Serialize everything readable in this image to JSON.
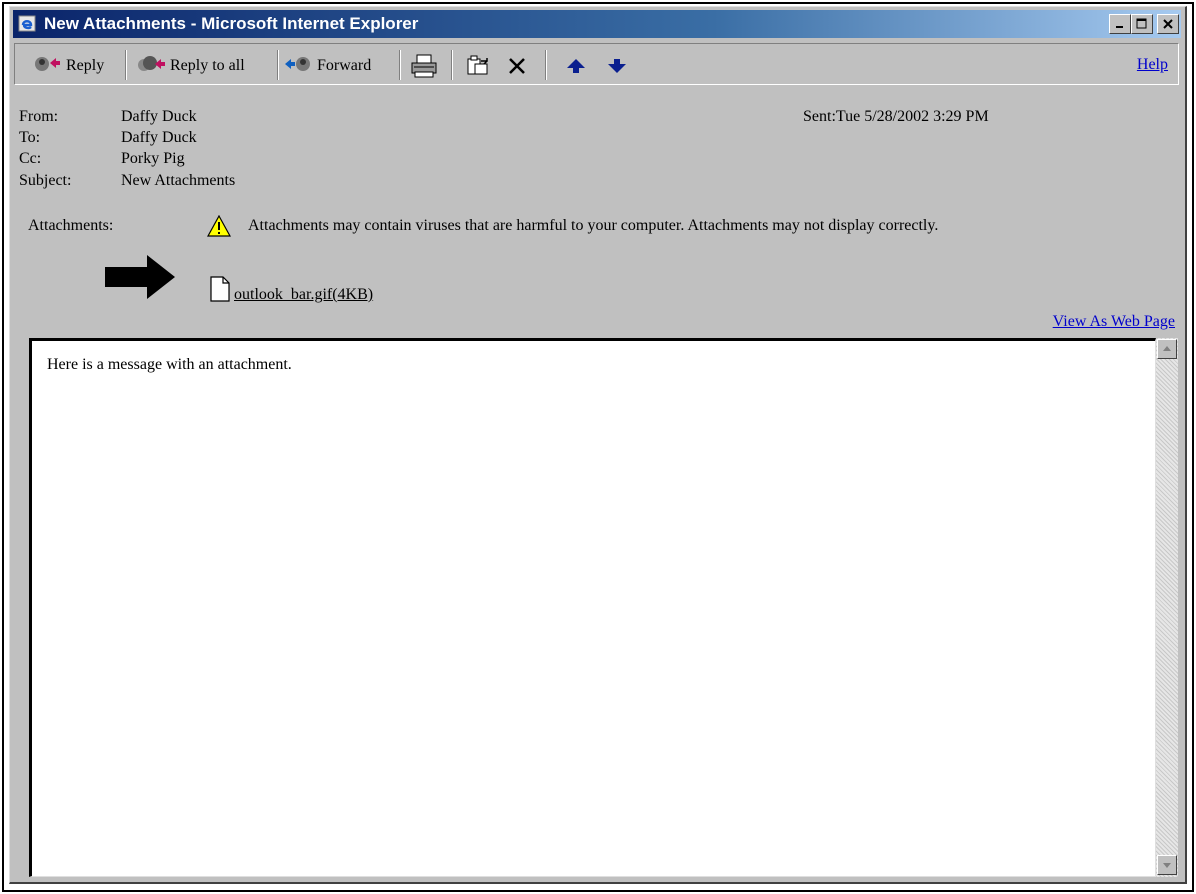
{
  "window": {
    "title": "New Attachments - Microsoft Internet Explorer"
  },
  "toolbar": {
    "reply": "Reply",
    "reply_all": "Reply to all",
    "forward": "Forward",
    "help": "Help",
    "icons": [
      "reply-icon",
      "reply-all-icon",
      "forward-icon",
      "print-icon",
      "move-to-folder-icon",
      "delete-icon",
      "previous-item-icon",
      "next-item-icon"
    ]
  },
  "headers": {
    "from_label": "From:",
    "from_value": "Daffy Duck",
    "to_label": "To:",
    "to_value": "Daffy Duck",
    "cc_label": "Cc:",
    "cc_value": "Porky Pig",
    "subject_label": "Subject:",
    "subject_value": "New Attachments",
    "sent": "Sent:Tue 5/28/2002 3:29 PM"
  },
  "attachments": {
    "label": "Attachments:",
    "warning": "Attachments may contain viruses that are harmful to your computer. Attachments may not display correctly.",
    "file": "outlook_bar.gif(4KB)"
  },
  "view_as_web_page": "View As Web Page",
  "message_body": "Here is a message with an attachment.",
  "colors": {
    "title_bar": "#0a246a",
    "link": "#0000cc",
    "warning_icon": "#ffff00"
  }
}
